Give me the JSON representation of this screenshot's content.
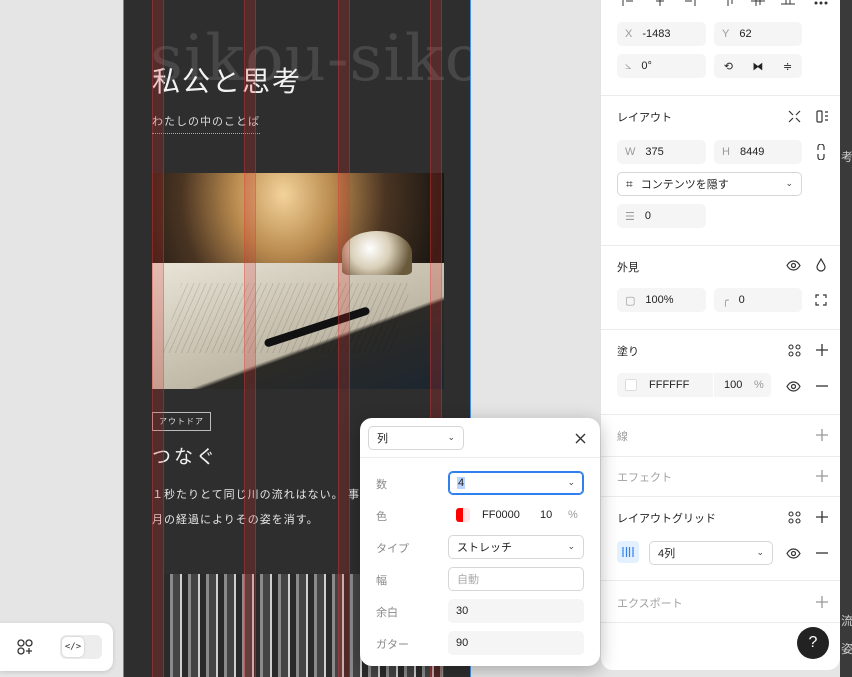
{
  "canvas": {
    "bg_word": "sikou-sikou",
    "title": "私公と思考",
    "subtitle": "わたしの中のことば",
    "tag": "アウトドア",
    "heading": "つなぐ",
    "paragraph_line1": "１秒たりとて同じ川の流れはない。 事",
    "paragraph_line2": "月の経過によりその姿を消す。"
  },
  "left_toolbar": {
    "icon_shapes": "shapes-plus-icon",
    "icon_code": "code-icon",
    "code_glyph": "</>"
  },
  "position": {
    "x_label": "X",
    "x_value": "-1483",
    "y_label": "Y",
    "y_value": "62",
    "rotation_value": "0°"
  },
  "layout": {
    "title": "レイアウト",
    "w_label": "W",
    "w_value": "375",
    "h_label": "H",
    "h_value": "8449",
    "clip_option": "コンテンツを隠す",
    "gap_value": "0"
  },
  "appearance": {
    "title": "外見",
    "opacity_value": "100%",
    "radius_value": "0"
  },
  "fill": {
    "title": "塗り",
    "hex": "FFFFFF",
    "opacity": "100",
    "percent": "%",
    "color": "#FFFFFF"
  },
  "stroke": {
    "title": "線"
  },
  "effects": {
    "title": "エフェクト"
  },
  "layout_grid": {
    "title": "レイアウトグリッド",
    "grid_value": "4列"
  },
  "export": {
    "title": "エクスポート"
  },
  "help": {
    "label": "?"
  },
  "right_strip": {
    "char1": "考",
    "char2": "流",
    "char3": "姿"
  },
  "popup": {
    "type_select": "列",
    "count_label": "数",
    "count_value": "4",
    "color_label": "色",
    "color_hex": "FF0000",
    "color_opacity": "10",
    "color_percent": "%",
    "color": "#FF0000",
    "kind_label": "タイプ",
    "kind_value": "ストレッチ",
    "width_label": "幅",
    "width_placeholder": "自動",
    "margin_label": "余白",
    "margin_value": "30",
    "gutter_label": "ガター",
    "gutter_value": "90"
  }
}
